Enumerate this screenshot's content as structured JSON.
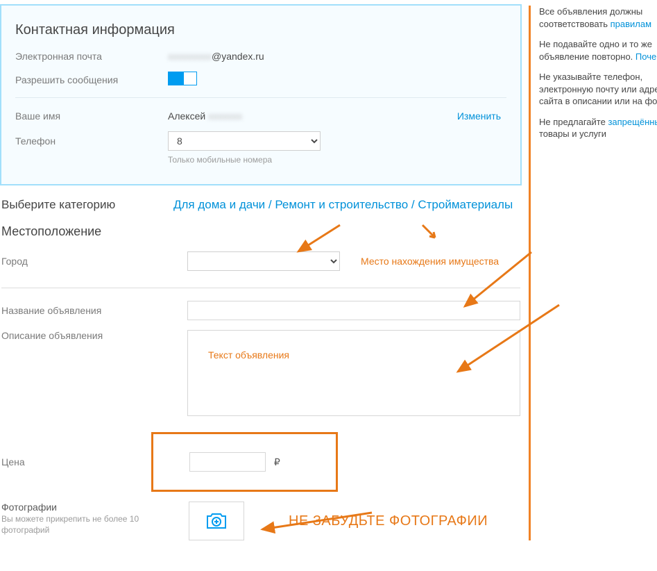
{
  "contact": {
    "section_title": "Контактная информация",
    "email_label": "Электронная почта",
    "email_value_suffix": "@yandex.ru",
    "allow_msg_label": "Разрешить сообщения",
    "name_label": "Ваше имя",
    "name_value": "Алексей",
    "change_link": "Изменить",
    "phone_label": "Телефон",
    "phone_value": "8",
    "phone_hint": "Только мобильные номера"
  },
  "category": {
    "label": "Выберите категорию",
    "breadcrumb": "Для дома и дачи / Ремонт и строительство / Стройматериалы"
  },
  "location": {
    "section_title": "Местоположение",
    "city_label": "Город",
    "city_value": "",
    "annotation": "Место нахождения имущества"
  },
  "ad": {
    "title_label": "Название объявления",
    "title_value": "",
    "desc_label": "Описание объявления",
    "desc_value": "",
    "desc_annotation": "Текст объявления",
    "price_label": "Цена",
    "price_value": "",
    "currency_symbol": "₽"
  },
  "photos": {
    "label": "Фотографии",
    "hint": "Вы можете прикрепить не более 10 фотографий",
    "annotation": "НЕ ЗАБУДЬТЕ ФОТОГРАФИИ"
  },
  "sidebar": {
    "rule1_a": "Все объявления должны",
    "rule1_b": "соответствовать ",
    "rule1_link": "правилам",
    "rule2_a": "Не подавайте одно и то же",
    "rule2_b": "объявление повторно. ",
    "rule2_link": "Почему?",
    "rule3_a": "Не указывайте телефон,",
    "rule3_b": "электронную почту или адрес",
    "rule3_c": "сайта в описании или на фото",
    "rule4_a": "Не предлагайте ",
    "rule4_link": "запрещённые",
    "rule4_b": "товары и услуги"
  }
}
